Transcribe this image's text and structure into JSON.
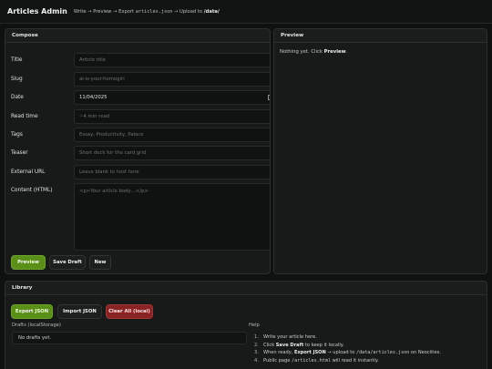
{
  "header": {
    "title": "Articles Admin",
    "steps": {
      "write": "Write",
      "arrow": "→",
      "preview": "Preview",
      "export_prefix": "Export",
      "export_file": "articles.json",
      "upload_prefix": "Upload to",
      "upload_dir": "/data/"
    }
  },
  "compose": {
    "heading": "Compose",
    "fields": {
      "title": {
        "label": "Title",
        "value": "",
        "placeholder": "Article title"
      },
      "slug": {
        "label": "Slug",
        "value": "",
        "placeholder": "ai-is-your-homegirl"
      },
      "date": {
        "label": "Date",
        "value": "11/04/2025",
        "placeholder": ""
      },
      "read_time": {
        "label": "Read time",
        "value": "",
        "placeholder": "~4 min read"
      },
      "tags": {
        "label": "Tags",
        "value": "",
        "placeholder": "Essay, Productivity, Palace"
      },
      "teaser": {
        "label": "Teaser",
        "value": "",
        "placeholder": "Short deck for the card grid"
      },
      "external_url": {
        "label": "External URL",
        "value": "",
        "placeholder": "Leave blank to host here"
      },
      "content": {
        "label": "Content (HTML)",
        "value": "",
        "placeholder": "<p>Your article body…</p>"
      }
    },
    "buttons": {
      "preview": "Preview",
      "save_draft": "Save Draft",
      "new": "New"
    }
  },
  "preview": {
    "heading": "Preview",
    "empty_prefix": "Nothing yet. Click",
    "empty_action": "Preview",
    "empty_suffix": "."
  },
  "library": {
    "heading": "Library",
    "buttons": {
      "export_json": "Export JSON",
      "import_json": "Import JSON",
      "clear_all": "Clear All (local)"
    },
    "drafts_label": "Drafts (localStorage)",
    "drafts_empty": "No drafts yet.",
    "help_label": "Help",
    "help": [
      {
        "num": "1.",
        "pre": "Write your article here.",
        "b": "",
        "mid": "",
        "code": "",
        "b2": "",
        "post": "",
        "code2": "",
        "end": ""
      },
      {
        "num": "2.",
        "pre": "Click ",
        "b": "Save Draft",
        "mid": " to keep it locally.",
        "code": "",
        "b2": "",
        "post": "",
        "code2": "",
        "end": ""
      },
      {
        "num": "3.",
        "pre": "When ready, ",
        "b": "Export JSON",
        "mid": " → upload to ",
        "code": "/data/articles.json",
        "b2": "",
        "post": " on Neocities.",
        "code2": "",
        "end": ""
      },
      {
        "num": "4.",
        "pre": "Public page ",
        "b": "",
        "mid": "",
        "code": "/articles.html",
        "b2": "",
        "post": " will read it instantly.",
        "code2": "",
        "end": ""
      }
    ]
  },
  "colors": {
    "accent_green": "#5a8f18",
    "danger_red": "#8a2424",
    "background": "#0f1110"
  }
}
